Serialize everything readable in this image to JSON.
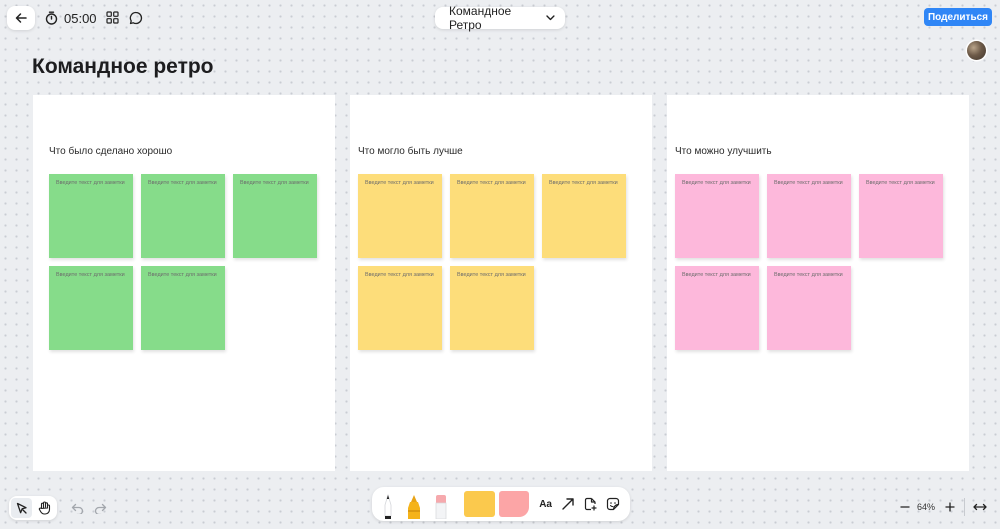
{
  "header": {
    "timer": "05:00",
    "board_title": "Командное Ретро",
    "share_label": "Поделиться"
  },
  "page_title": "Командное ретро",
  "note_placeholder": "Введите текст для заметки",
  "columns": [
    {
      "title": "Что было сделано хорошо",
      "color": "#86dc8a"
    },
    {
      "title": "Что могло быть лучше",
      "color": "#fddd7a"
    },
    {
      "title": "Что можно улучшить",
      "color": "#fdb8db"
    }
  ],
  "toolbar": {
    "text_tool_label": "Aa",
    "tools": [
      "pen-icon",
      "marker-icon",
      "eraser-icon",
      "sticky-note-yellow",
      "sticky-note-pink",
      "text-tool",
      "arrow-icon",
      "add-file-icon",
      "sticker-icon"
    ]
  },
  "zoom": {
    "level": "64%"
  },
  "colors": {
    "accent": "#2f86f6",
    "background": "#eceef1"
  }
}
